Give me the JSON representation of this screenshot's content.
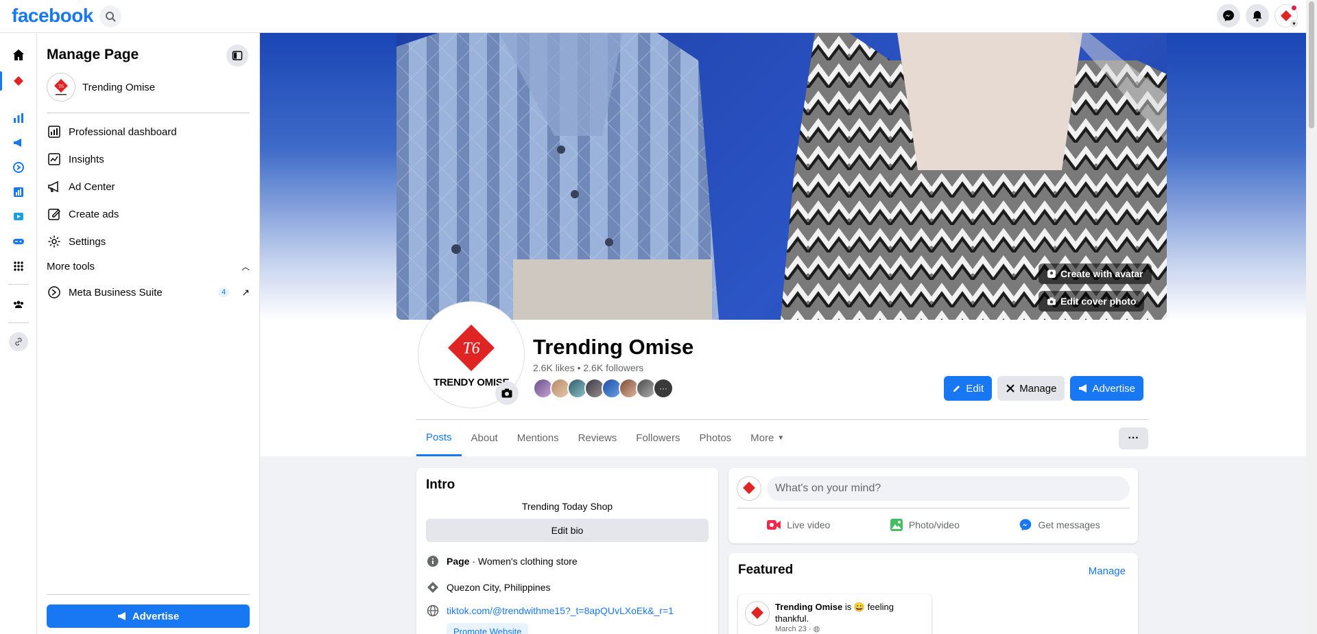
{
  "topbar": {
    "logo": "facebook"
  },
  "panel": {
    "title": "Manage Page",
    "page_name": "Trending Omise",
    "menu": [
      {
        "label": "Professional dashboard",
        "icon": "dashboard-icon"
      },
      {
        "label": "Insights",
        "icon": "insights-icon"
      },
      {
        "label": "Ad Center",
        "icon": "megaphone-icon"
      },
      {
        "label": "Create ads",
        "icon": "pencil-icon"
      },
      {
        "label": "Settings",
        "icon": "gear-icon"
      }
    ],
    "more_tools": "More tools",
    "meta_business_suite": {
      "label": "Meta Business Suite",
      "badge": "4"
    },
    "advertise": "Advertise"
  },
  "cover": {
    "create_avatar": "Create with avatar",
    "edit_cover": "Edit cover photo"
  },
  "profile": {
    "logo_mark": "T6",
    "logo_text": "TRENDY OMISE",
    "name": "Trending Omise",
    "stats": "2.6K likes • 2.6K followers"
  },
  "actions": {
    "edit": "Edit",
    "manage": "Manage",
    "advertise": "Advertise"
  },
  "tabs": [
    "Posts",
    "About",
    "Mentions",
    "Reviews",
    "Followers",
    "Photos",
    "More"
  ],
  "intro": {
    "title": "Intro",
    "bio": "Trending Today Shop",
    "edit_bio": "Edit bio",
    "category_bold": "Page",
    "category": " · Women's clothing store",
    "location": "Quezon City, Philippines",
    "website": "tiktok.com/@trendwithme15?_t=8apQUvLXoEk&_r=1",
    "promote": "Promote Website"
  },
  "composer": {
    "placeholder": "What's on your mind?",
    "live": "Live video",
    "photo": "Photo/video",
    "messages": "Get messages"
  },
  "featured": {
    "title": "Featured",
    "manage": "Manage",
    "post_name": "Trending Omise",
    "post_text": " is 😀 feeling thankful.",
    "post_date": "March 23 · "
  },
  "colors": {
    "accent": "#1877f2",
    "brand_red": "#e02424"
  }
}
